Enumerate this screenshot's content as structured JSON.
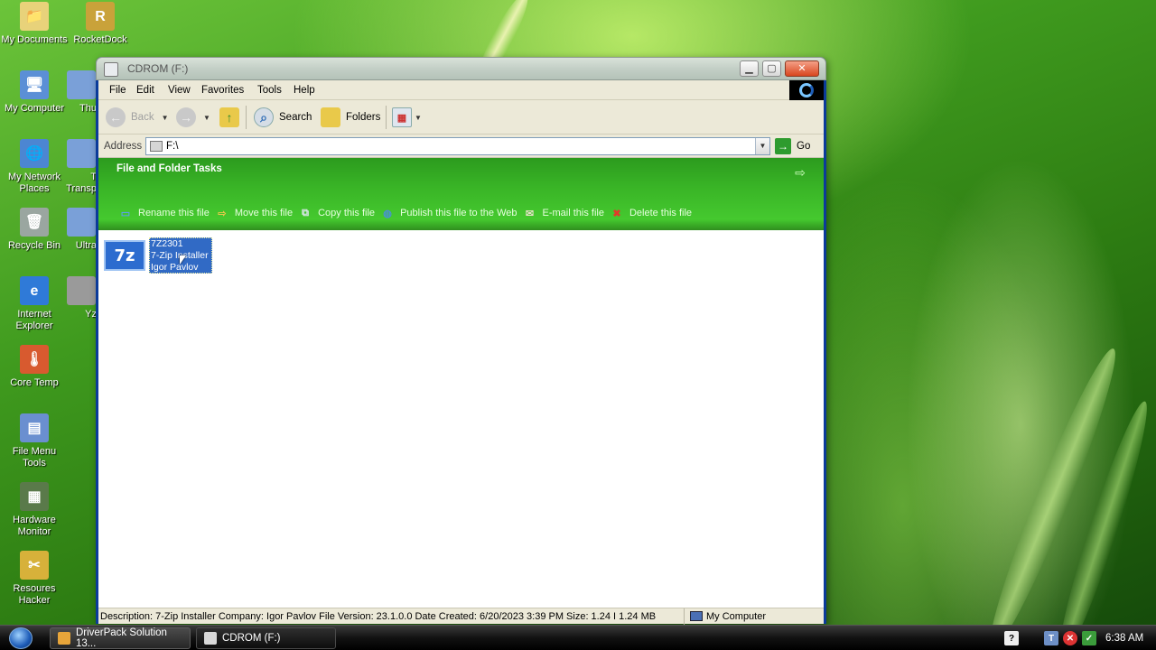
{
  "desktop": {
    "icons": [
      {
        "label": "My Documents",
        "icon": "my-documents-icon",
        "glyph": "📁",
        "color": "#e8d27a"
      },
      {
        "label": "RocketDock",
        "icon": "rocketdock-icon",
        "glyph": "R",
        "color": "#c9a23a"
      },
      {
        "label": "My Computer",
        "icon": "my-computer-icon",
        "glyph": "🖥",
        "color": "#5b8fd6"
      },
      {
        "label": "Thu",
        "icon": "partial-icon",
        "glyph": "",
        "color": "#7aa0d8"
      },
      {
        "label": "My Network Places",
        "icon": "network-places-icon",
        "glyph": "🌐",
        "color": "#4c86d2"
      },
      {
        "label": "T Transp",
        "icon": "partial-icon",
        "glyph": "",
        "color": "#7aa0d8"
      },
      {
        "label": "Recycle Bin",
        "icon": "recycle-bin-icon",
        "glyph": "🗑",
        "color": "#9aa6a0"
      },
      {
        "label": "Ultra",
        "icon": "partial-icon",
        "glyph": "",
        "color": "#7aa0d8"
      },
      {
        "label": "Internet Explorer",
        "icon": "internet-explorer-icon",
        "glyph": "e",
        "color": "#2f7ad8"
      },
      {
        "label": "Yz",
        "icon": "partial-icon",
        "glyph": "",
        "color": "#9a9a9a"
      },
      {
        "label": "Core Temp",
        "icon": "core-temp-icon",
        "glyph": "🌡",
        "color": "#d85a2f"
      },
      {
        "label": "File Menu Tools",
        "icon": "file-menu-tools-icon",
        "glyph": "▤",
        "color": "#6a8fd0"
      },
      {
        "label": "Hardware Monitor",
        "icon": "hardware-monitor-icon",
        "glyph": "▦",
        "color": "#5a7a4a"
      },
      {
        "label": "Resoures Hacker",
        "icon": "resource-hacker-icon",
        "glyph": "✂",
        "color": "#d7b13a"
      }
    ]
  },
  "window": {
    "title": "CDROM (F:)",
    "menu": [
      "File",
      "Edit",
      "View",
      "Favorites",
      "Tools",
      "Help"
    ],
    "toolbar": {
      "back": "Back",
      "search": "Search",
      "folders": "Folders"
    },
    "address": {
      "label": "Address",
      "value": "F:\\",
      "go": "Go"
    },
    "taskpane": {
      "title": "File and Folder Tasks",
      "tasks": [
        {
          "label": "Rename this file",
          "icon": "rename-icon",
          "glyph": "▭",
          "color": "#5aa0e6"
        },
        {
          "label": "Move this file",
          "icon": "move-file-icon",
          "glyph": "⇨",
          "color": "#e6c84a"
        },
        {
          "label": "Copy this file",
          "icon": "copy-file-icon",
          "glyph": "⧉",
          "color": "#dfe8f0"
        },
        {
          "label": "Publish this file to the Web",
          "icon": "publish-web-icon",
          "glyph": "◍",
          "color": "#4a8fd8"
        },
        {
          "label": "E-mail this file",
          "icon": "email-icon",
          "glyph": "✉",
          "color": "#e6e0c8"
        },
        {
          "label": "Delete this file",
          "icon": "delete-icon",
          "glyph": "✖",
          "color": "#e23a2a"
        }
      ]
    },
    "file": {
      "icon_label": "7z",
      "line1": "7Z2301",
      "line2": "7-Zip Installer",
      "line3": "Igor Pavlov"
    },
    "status": {
      "description": "Description: 7-Zip Installer Company: Igor Pavlov File Version: 23.1.0.0 Date Created: 6/20/2023 3:39 PM Size: 1.24 I 1.24 MB",
      "zone": "My Computer"
    }
  },
  "taskbar": {
    "items": [
      "DriverPack Solution 13...",
      "CDROM (F:)"
    ],
    "clock": "6:38 AM"
  }
}
